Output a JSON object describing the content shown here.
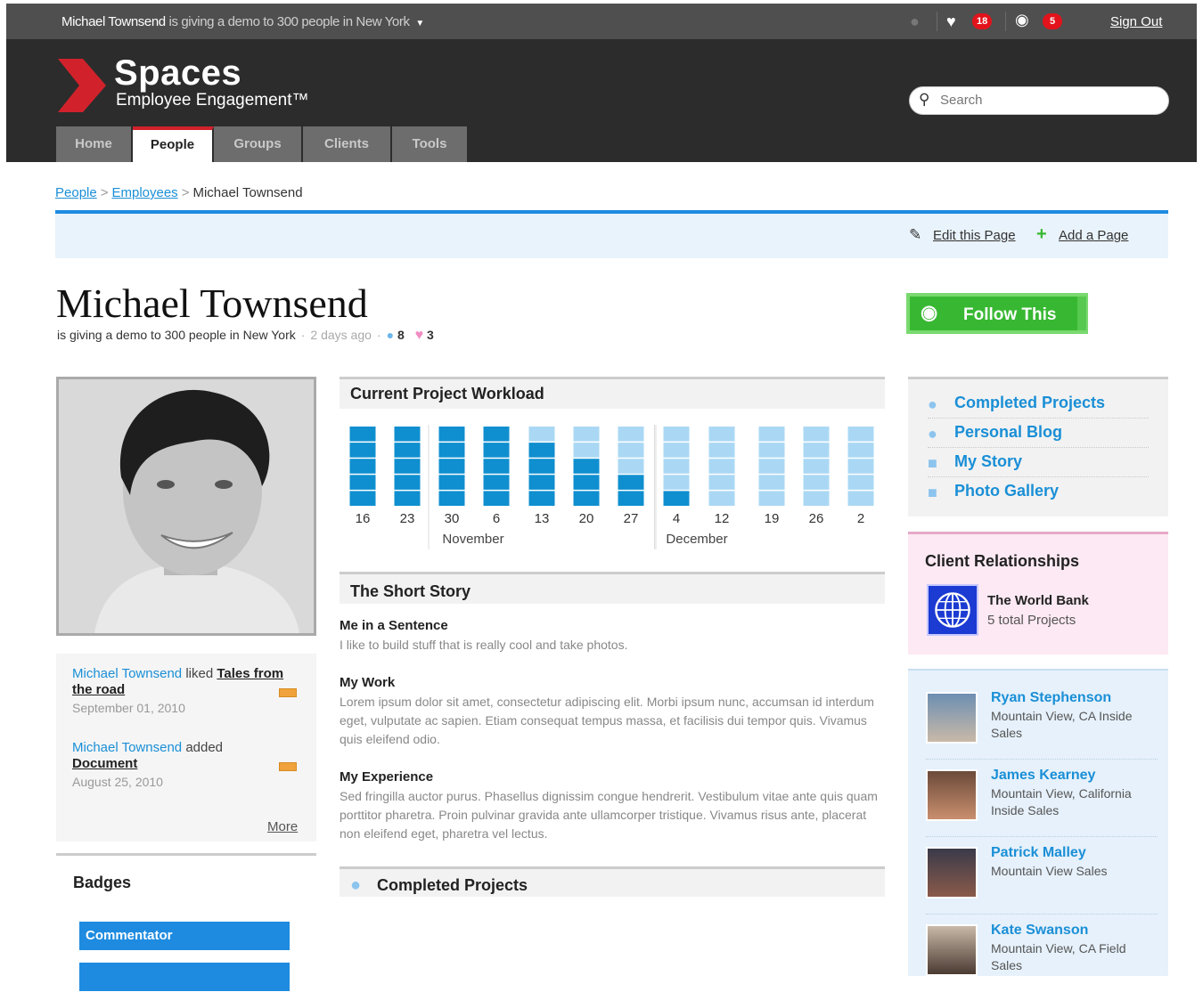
{
  "topbar": {
    "user": "Michael Townsend",
    "status": "is giving a demo to 300 people in New York",
    "likes_count": "18",
    "watch_count": "5",
    "signout": "Sign Out"
  },
  "brand": {
    "name": "Spaces",
    "tagline": "Employee Engagement™",
    "colors": {
      "accent": "#d1222b",
      "link": "#1a8fd6",
      "primary": "#1e8be0",
      "follow": "#38b832"
    }
  },
  "search": {
    "placeholder": "Search"
  },
  "nav": {
    "tabs": [
      "Home",
      "People",
      "Groups",
      "Clients",
      "Tools"
    ],
    "active": "People"
  },
  "breadcrumb": {
    "items": [
      "People",
      "Employees"
    ],
    "current": "Michael Townsend"
  },
  "page_actions": {
    "edit": "Edit this Page",
    "add": "Add a Page"
  },
  "profile": {
    "name": "Michael Townsend",
    "status": "is giving a demo to 300 people in New York",
    "time": "2 days ago",
    "comments": "8",
    "likes": "3",
    "follow": "Follow This"
  },
  "activity": [
    {
      "user": "Michael Townsend",
      "verb": "liked",
      "object": "Tales from the road",
      "date": "September 01, 2010"
    },
    {
      "user": "Michael Townsend",
      "verb": "added",
      "object": "Document",
      "date": "August 25, 2010"
    }
  ],
  "activity_more": "More",
  "badges": {
    "title": "Badges",
    "items": [
      "Commentator",
      ""
    ]
  },
  "workload": {
    "title": "Current Project Workload"
  },
  "chart_data": {
    "type": "bar",
    "title": "Current Project Workload",
    "categories": [
      "16",
      "23",
      "30",
      "6",
      "13",
      "20",
      "27",
      "4",
      "12",
      "19",
      "26",
      "2"
    ],
    "values": [
      5,
      5,
      5,
      5,
      4,
      3,
      2,
      1,
      0,
      0,
      0,
      0
    ],
    "capacity": 5,
    "month_labels": [
      {
        "label": "November",
        "after_index": 2
      },
      {
        "label": "December",
        "after_index": 7
      }
    ]
  },
  "story": {
    "title": "The Short Story",
    "sentence_title": "Me in a Sentence",
    "sentence": "I like to build stuff that is really cool and take photos.",
    "work_title": "My Work",
    "work": "Lorem ipsum dolor sit amet, consectetur adipiscing elit. Morbi ipsum nunc, accumsan id interdum eget, vulputate ac sapien. Etiam consequat tempus massa, et facilisis dui tempor quis. Vivamus quis eleifend odio.",
    "experience_title": "My Experience",
    "experience": "Sed fringilla auctor purus. Phasellus dignissim congue hendrerit. Vestibulum vitae ante quis quam porttitor pharetra. Proin pulvinar gravida ante ullamcorper tristique. Vivamus risus ante, placerat non eleifend eget, pharetra vel lectus."
  },
  "completed": {
    "title": "Completed Projects"
  },
  "right_links": [
    "Completed Projects",
    "Personal Blog",
    "My Story",
    "Photo Gallery"
  ],
  "clients": {
    "title": "Client Relationships",
    "name": "The World Bank",
    "projects": "5 total Projects"
  },
  "people": [
    {
      "name": "Ryan Stephenson",
      "location": "Mountain View, CA Inside Sales"
    },
    {
      "name": "James Kearney",
      "location": "Mountain View, California Inside Sales"
    },
    {
      "name": "Patrick Malley",
      "location": "Mountain View Sales"
    },
    {
      "name": "Kate Swanson",
      "location": "Mountain View, CA Field Sales"
    }
  ]
}
